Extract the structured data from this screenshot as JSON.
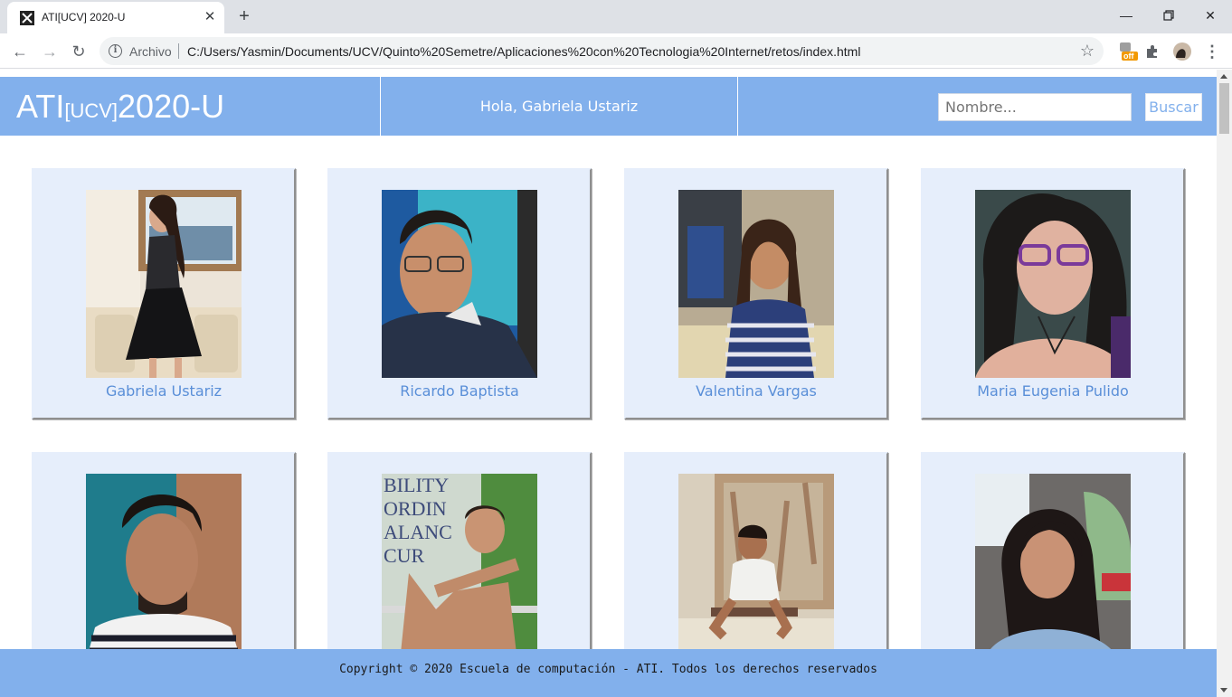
{
  "browser": {
    "tab_title": "ATI[UCV] 2020-U",
    "scheme_label": "Archivo",
    "url": "C:/Users/Yasmin/Documents/UCV/Quinto%20Semetre/Aplicaciones%20con%20Tecnologia%20Internet/retos/index.html",
    "extension_badge": "off"
  },
  "header": {
    "logo_main": "ATI",
    "logo_sub": "[UCV]",
    "logo_year": "2020-U",
    "greeting": "Hola, Gabriela Ustariz",
    "search_placeholder": "Nombre...",
    "search_button": "Buscar",
    "color": "#82b0ec"
  },
  "students": [
    {
      "name": "Gabriela Ustariz",
      "photo": "woman-black-dress-photo"
    },
    {
      "name": "Ricardo Baptista",
      "photo": "man-glasses-photo"
    },
    {
      "name": "Valentina Vargas",
      "photo": "woman-striped-shirt-photo"
    },
    {
      "name": "Maria Eugenia Pulido",
      "photo": "woman-purple-glasses-photo"
    },
    {
      "name": "",
      "photo": "man-striped-shirt-photo"
    },
    {
      "name": "",
      "photo": "man-exercise-photo"
    },
    {
      "name": "",
      "photo": "boy-sitting-photo"
    },
    {
      "name": "",
      "photo": "woman-car-selfie-photo"
    }
  ],
  "footer": {
    "text": "Copyright © 2020 Escuela de computación - ATI. Todos los derechos reservados"
  }
}
